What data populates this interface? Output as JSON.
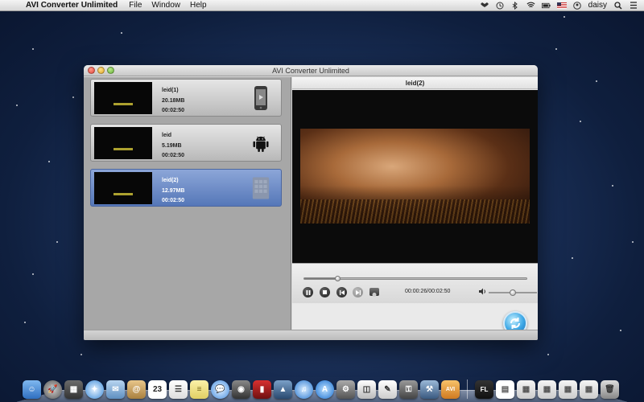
{
  "menubar": {
    "apple_glyph": "",
    "app_name": "AVI Converter Unlimited",
    "menus": [
      "File",
      "Window",
      "Help"
    ],
    "user": "daisy",
    "status_icons": [
      "dropbox-icon",
      "time-machine-icon",
      "bluetooth-icon",
      "wifi-icon",
      "battery-icon",
      "flag-us-icon",
      "user-icon",
      "spotlight-icon",
      "list-icon"
    ]
  },
  "window": {
    "title": "AVI Converter Unlimited",
    "items": [
      {
        "name": "leid(1)",
        "size": "20.18MB",
        "duration": "00:02:50",
        "device": "iphone-icon",
        "selected": false
      },
      {
        "name": "leid",
        "size": "5.19MB",
        "duration": "00:02:50",
        "device": "android-icon",
        "selected": false
      },
      {
        "name": "leid(2)",
        "size": "12.97MB",
        "duration": "00:02:50",
        "device": "tablet-icon",
        "selected": true
      }
    ],
    "preview": {
      "title": "leid(2)",
      "time_display": "00:00:26/00:02:50",
      "progress_fraction": 0.15,
      "volume_fraction": 0.5
    }
  },
  "dock": {
    "icons": [
      "finder-icon",
      "launchpad-icon",
      "mission-control-icon",
      "safari-icon",
      "mail-icon",
      "contacts-icon",
      "calendar-icon",
      "reminders-icon",
      "notes-icon",
      "messages-icon",
      "facetime-icon",
      "photo-booth-icon",
      "iphoto-icon",
      "itunes-icon",
      "app-store-icon",
      "system-preferences-icon",
      "preview-icon",
      "textedit-icon",
      "keychain-icon",
      "xcode-icon",
      "avi-converter-icon",
      "fl-icon",
      "document-icon",
      "stack-icon",
      "stack-icon",
      "stack-icon",
      "stack-icon",
      "trash-icon"
    ],
    "calendar_day": "23",
    "fl_label": "FL",
    "avi_label": "AVI"
  }
}
